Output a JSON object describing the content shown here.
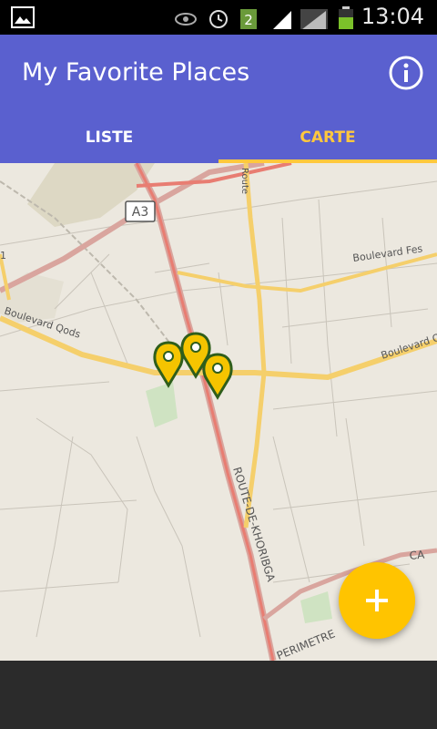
{
  "status_bar": {
    "time": "13:04",
    "notification_count": "2",
    "icons": [
      "gallery-icon",
      "eye-icon",
      "alarm-icon",
      "notification-badge-icon",
      "signal-icon",
      "signal-icon",
      "battery-icon"
    ]
  },
  "app_bar": {
    "title": "My Favorite Places",
    "info_icon": "info-icon"
  },
  "tabs": [
    {
      "label": "LISTE",
      "selected": false
    },
    {
      "label": "CARTE",
      "selected": true
    }
  ],
  "colors": {
    "primary": "#5a60cf",
    "accent": "#ffc83d",
    "fab": "#ffc400",
    "marker_fill": "#f5c400",
    "marker_stroke": "#2f5e1b"
  },
  "map": {
    "labels": {
      "a3": "A3",
      "boulevard_fes": "Boulevard Fes",
      "boulevard_qods_left": "Boulevard Qods",
      "boulevard_qods_right": "Boulevard Qo",
      "route_khouribga": "ROUTE-DE-KHORIBGA",
      "route_top": "Route",
      "perimetre": "PERIMETRE",
      "casablanca": "CA",
      "edge_letter": "1"
    },
    "markers": [
      "map-marker",
      "map-marker",
      "map-marker"
    ]
  },
  "fab": {
    "label": "+",
    "icon": "plus-icon"
  }
}
